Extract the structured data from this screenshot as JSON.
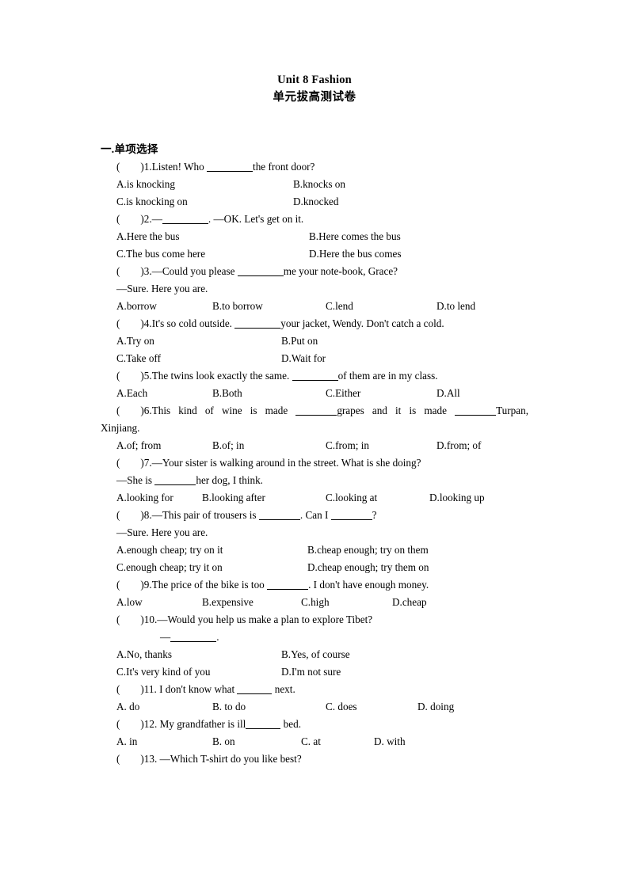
{
  "header": {
    "title": "Unit 8 Fashion",
    "subtitle": "单元拔高测试卷"
  },
  "section": {
    "heading": "一.单项选择"
  },
  "questions": [
    {
      "num": "1",
      "stem_pre": ")1.Listen! Who",
      "stem_post": "the front door?",
      "layout": "2col-370",
      "options": [
        "A.is knocking",
        "B.knocks on",
        "C.is knocking on",
        "D.knocked"
      ]
    },
    {
      "num": "2",
      "stem_pre": ")2.—",
      "stem_post": ". —OK. Let's get on it.",
      "layout": "2col-390",
      "options": [
        "A.Here the bus",
        "B.Here comes the bus",
        "C.The bus come here",
        "D.Here the bus comes"
      ]
    },
    {
      "num": "3",
      "stem_pre": ")3.—Could you please",
      "stem_post": "me your note-book, Grace?",
      "reply": "—Sure. Here you are.",
      "layout": "4col-wide",
      "options": [
        "A.borrow",
        "B.to borrow",
        "C.lend",
        "D.to lend"
      ]
    },
    {
      "num": "4",
      "stem_pre": ")4.It's so cold outside.",
      "stem_post": "your jacket, Wendy. Don't catch a cold.",
      "layout": "2col-355",
      "options": [
        "A.Try on",
        "B.Put on",
        "C.Take off",
        "D.Wait for"
      ]
    },
    {
      "num": "5",
      "stem_pre": ")5.The twins look exactly the same.",
      "stem_post": "of them are in my class.",
      "layout": "4col-narrow",
      "options": [
        "A.Each",
        "B.Both",
        "C.Either",
        "D.All"
      ]
    },
    {
      "num": "6",
      "stem_justified_a": ")6.This kind of wine is made",
      "stem_justified_b": "grapes and it is made",
      "stem_justified_c": "Turpan,",
      "stem_line2": "Xinjiang.",
      "layout": "4col-wide",
      "options": [
        "A.of; from",
        "B.of; in",
        "C.from; in",
        "D.from; of"
      ]
    },
    {
      "num": "7",
      "stem_full": ")7.—Your sister is walking around in the street. What is she doing?",
      "reply_pre": "—She is",
      "reply_post": "her dog, I think.",
      "layout": "4col-7",
      "options": [
        "A.looking for",
        "B.looking after",
        "C.looking at",
        "D.looking up"
      ]
    },
    {
      "num": "8",
      "stem_pre": ")8.—This pair of trousers is",
      "stem_mid": ". Can I",
      "stem_post": "?",
      "reply": "—Sure. Here you are.",
      "layout": "2col-388",
      "options": [
        "A.enough cheap; try on it",
        "B.cheap enough; try on them",
        "C.enough cheap; try it on",
        "D.cheap enough; try them on"
      ]
    },
    {
      "num": "9",
      "stem_pre": ")9.The price of the bike is too",
      "stem_post": ". I don't have enough money.",
      "layout": "4col-9",
      "options": [
        "A.low",
        "B.expensive",
        "C.high",
        "D.cheap"
      ]
    },
    {
      "num": "10",
      "stem_full": ")10.—Would you help us make a plan to explore Tibet?",
      "answer_dash": "—",
      "layout": "2col-355",
      "options": [
        "A.No, thanks",
        "B.Yes, of course",
        "C.It's very kind of you",
        "D.I'm not sure"
      ]
    },
    {
      "num": "11",
      "stem_pre": ")11. I don't know what",
      "stem_post": "next.",
      "layout": "4col-11",
      "options": [
        "A. do",
        "B. to do",
        "C. does",
        "D. doing"
      ]
    },
    {
      "num": "12",
      "stem_pre": ")12. My grandfather is ill",
      "stem_post": "bed.",
      "layout": "4col-12",
      "options": [
        "A. in",
        "B. on",
        "C. at",
        "D. with"
      ]
    },
    {
      "num": "13",
      "stem_full": ")13. —Which T-shirt do you like best?"
    }
  ],
  "glyphs": {
    "open_paren": "(",
    "blank_char": ""
  }
}
